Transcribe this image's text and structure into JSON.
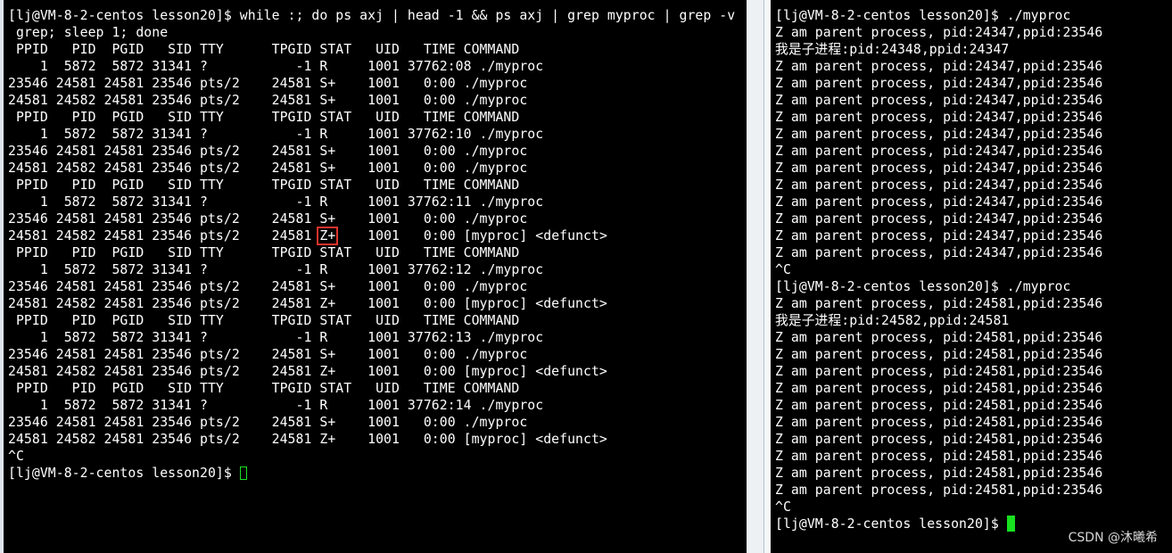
{
  "left_terminal": {
    "lines": [
      "[lj@VM-8-2-centos lesson20]$ while :; do ps axj | head -1 && ps axj | grep myproc | grep -v",
      " grep; sleep 1; done",
      " PPID   PID  PGID   SID TTY      TPGID STAT   UID   TIME COMMAND",
      "    1  5872  5872 31341 ?           -1 R     1001 37762:08 ./myproc",
      "23546 24581 24581 23546 pts/2    24581 S+    1001   0:00 ./myproc",
      "24581 24582 24581 23546 pts/2    24581 S+    1001   0:00 ./myproc",
      " PPID   PID  PGID   SID TTY      TPGID STAT   UID   TIME COMMAND",
      "    1  5872  5872 31341 ?           -1 R     1001 37762:10 ./myproc",
      "23546 24581 24581 23546 pts/2    24581 S+    1001   0:00 ./myproc",
      "24581 24582 24581 23546 pts/2    24581 S+    1001   0:00 ./myproc",
      " PPID   PID  PGID   SID TTY      TPGID STAT   UID   TIME COMMAND",
      "    1  5872  5872 31341 ?           -1 R     1001 37762:11 ./myproc",
      "23546 24581 24581 23546 pts/2    24581 S+    1001   0:00 ./myproc",
      "24581 24582 24581 23546 pts/2    24581 Z+    1001   0:00 [myproc] <defunct>",
      " PPID   PID  PGID   SID TTY      TPGID STAT   UID   TIME COMMAND",
      "    1  5872  5872 31341 ?           -1 R     1001 37762:12 ./myproc",
      "23546 24581 24581 23546 pts/2    24581 S+    1001   0:00 ./myproc",
      "24581 24582 24581 23546 pts/2    24581 Z+    1001   0:00 [myproc] <defunct>",
      " PPID   PID  PGID   SID TTY      TPGID STAT   UID   TIME COMMAND",
      "    1  5872  5872 31341 ?           -1 R     1001 37762:13 ./myproc",
      "23546 24581 24581 23546 pts/2    24581 S+    1001   0:00 ./myproc",
      "24581 24582 24581 23546 pts/2    24581 Z+    1001   0:00 [myproc] <defunct>",
      " PPID   PID  PGID   SID TTY      TPGID STAT   UID   TIME COMMAND",
      "    1  5872  5872 31341 ?           -1 R     1001 37762:14 ./myproc",
      "23546 24581 24581 23546 pts/2    24581 S+    1001   0:00 ./myproc",
      "24581 24582 24581 23546 pts/2    24581 Z+    1001   0:00 [myproc] <defunct>",
      "^C"
    ],
    "highlight": {
      "line": 13,
      "text": "Z+"
    },
    "prompt": "[lj@VM-8-2-centos lesson20]$ "
  },
  "right_terminal": {
    "lines": [
      "[lj@VM-8-2-centos lesson20]$ ./myproc",
      "Z am parent process, pid:24347,ppid:23546",
      "我是子进程:pid:24348,ppid:24347",
      "Z am parent process, pid:24347,ppid:23546",
      "Z am parent process, pid:24347,ppid:23546",
      "Z am parent process, pid:24347,ppid:23546",
      "Z am parent process, pid:24347,ppid:23546",
      "Z am parent process, pid:24347,ppid:23546",
      "Z am parent process, pid:24347,ppid:23546",
      "Z am parent process, pid:24347,ppid:23546",
      "Z am parent process, pid:24347,ppid:23546",
      "Z am parent process, pid:24347,ppid:23546",
      "Z am parent process, pid:24347,ppid:23546",
      "Z am parent process, pid:24347,ppid:23546",
      "Z am parent process, pid:24347,ppid:23546",
      "^C",
      "[lj@VM-8-2-centos lesson20]$ ./myproc",
      "Z am parent process, pid:24581,ppid:23546",
      "我是子进程:pid:24582,ppid:24581",
      "Z am parent process, pid:24581,ppid:23546",
      "Z am parent process, pid:24581,ppid:23546",
      "Z am parent process, pid:24581,ppid:23546",
      "Z am parent process, pid:24581,ppid:23546",
      "Z am parent process, pid:24581,ppid:23546",
      "Z am parent process, pid:24581,ppid:23546",
      "Z am parent process, pid:24581,ppid:23546",
      "Z am parent process, pid:24581,ppid:23546",
      "Z am parent process, pid:24581,ppid:23546",
      "Z am parent process, pid:24581,ppid:23546",
      "^C"
    ],
    "prompt": "[lj@VM-8-2-centos lesson20]$ "
  },
  "watermark": "CSDN @沐曦希",
  "colors": {
    "terminal_bg": "#000000",
    "terminal_fg": "#ffffff",
    "cursor": "#18e020",
    "highlight_box": "#e0332c"
  }
}
